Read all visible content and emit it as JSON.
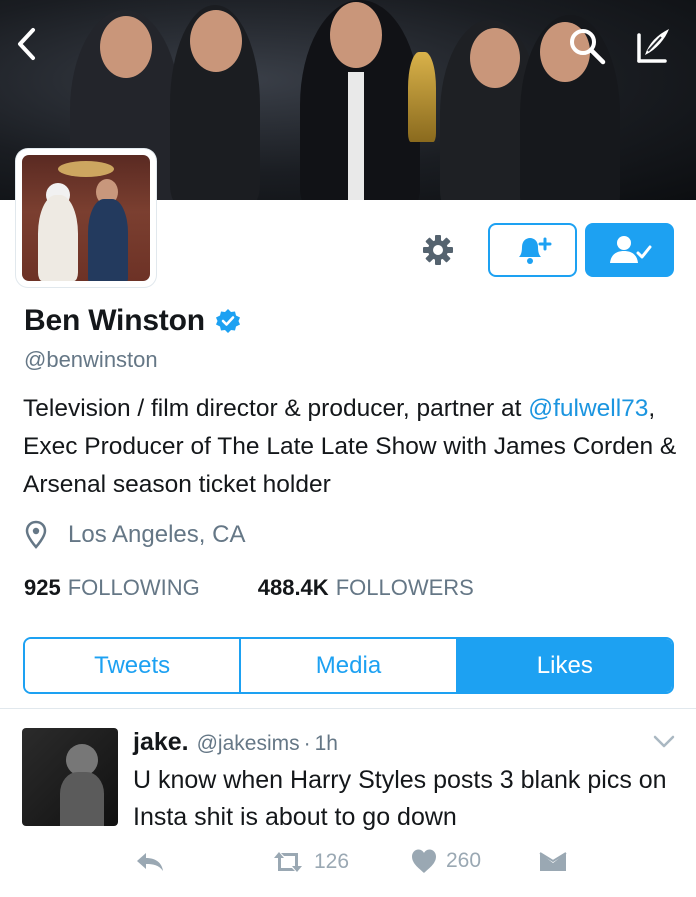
{
  "profile": {
    "name": "Ben Winston",
    "handle": "@benwinston",
    "bio_prefix": "Television / film director & producer, partner at ",
    "bio_mention": "@fulwell73",
    "bio_suffix": ", Exec Producer of The Late Late Show with James Corden & Arsenal season ticket holder",
    "location": "Los Angeles, CA",
    "verified": true
  },
  "stats": {
    "following_count": "925",
    "following_label": "FOLLOWING",
    "followers_count": "488.4K",
    "followers_label": "FOLLOWERS"
  },
  "tabs": [
    {
      "label": "Tweets",
      "active": false
    },
    {
      "label": "Media",
      "active": false
    },
    {
      "label": "Likes",
      "active": true
    }
  ],
  "tweet": {
    "name": "jake.",
    "handle": "@jakesims",
    "separator": "·",
    "time": "1h",
    "text": "U know when Harry Styles posts 3 blank pics on Insta shit is about to go down",
    "retweets": "126",
    "likes": "260"
  },
  "icons": {
    "back": "chevron-left-icon",
    "search": "search-icon",
    "compose": "compose-icon",
    "settings": "gear-icon",
    "notifications": "bell-plus-icon",
    "following": "user-check-icon",
    "verified": "verified-badge-icon",
    "location": "location-pin-icon",
    "caret": "chevron-down-icon",
    "reply": "reply-icon",
    "retweet": "retweet-icon",
    "like": "heart-icon",
    "dm": "envelope-icon"
  },
  "colors": {
    "accent": "#1da1f2",
    "mention": "#1b95e0",
    "secondary_text": "#657786",
    "action_gray": "#9aa8b3"
  }
}
